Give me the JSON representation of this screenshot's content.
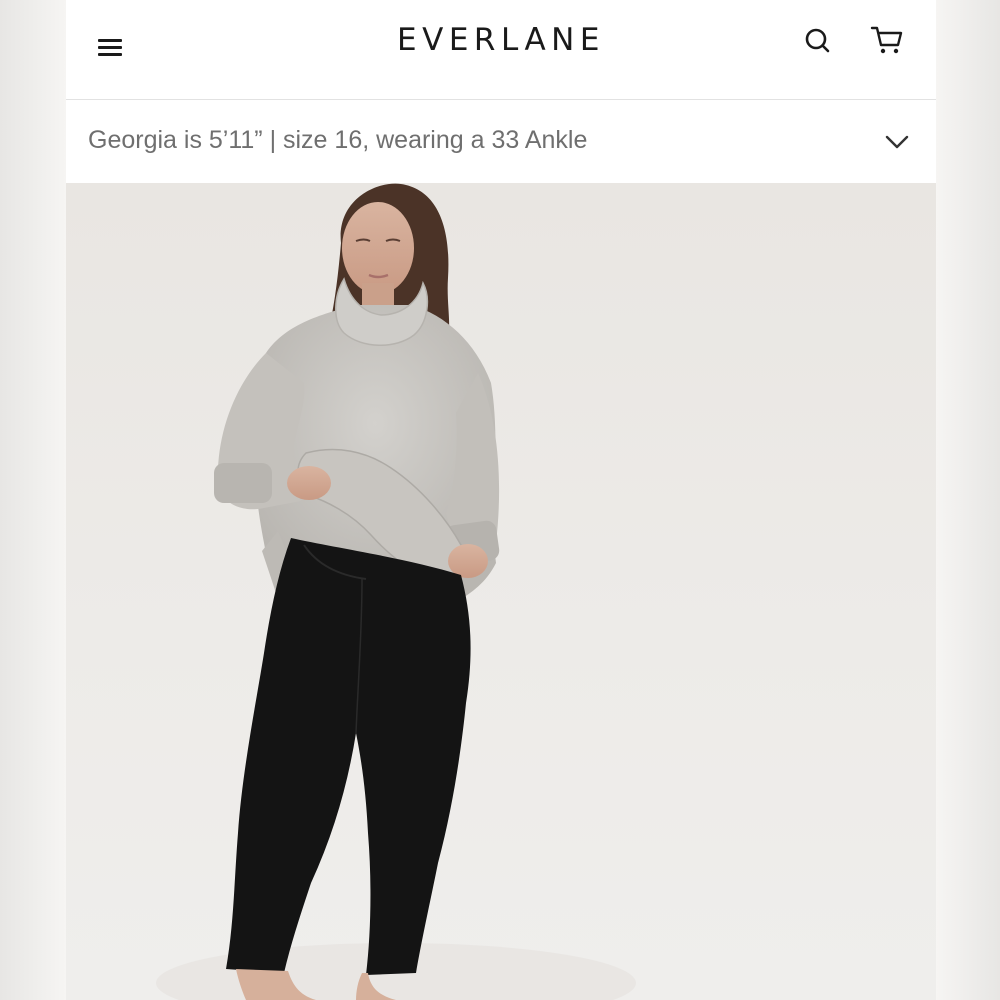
{
  "header": {
    "brand": "EVERLANE",
    "menu_icon": "hamburger-menu-icon",
    "search_icon": "search-icon",
    "cart_icon": "shopping-cart-icon"
  },
  "model_info": {
    "text": "Georgia is 5’11” | size 16, wearing a 33 Ankle",
    "toggle_icon": "chevron-down-icon"
  },
  "product_image": {
    "description_icon": "product-photo"
  },
  "colors": {
    "text_primary": "#1a1a1a",
    "text_secondary": "#6f6f6f",
    "photo_background": "#ebe9e6",
    "sweater": "#c9c7c3",
    "jeans": "#141414"
  }
}
